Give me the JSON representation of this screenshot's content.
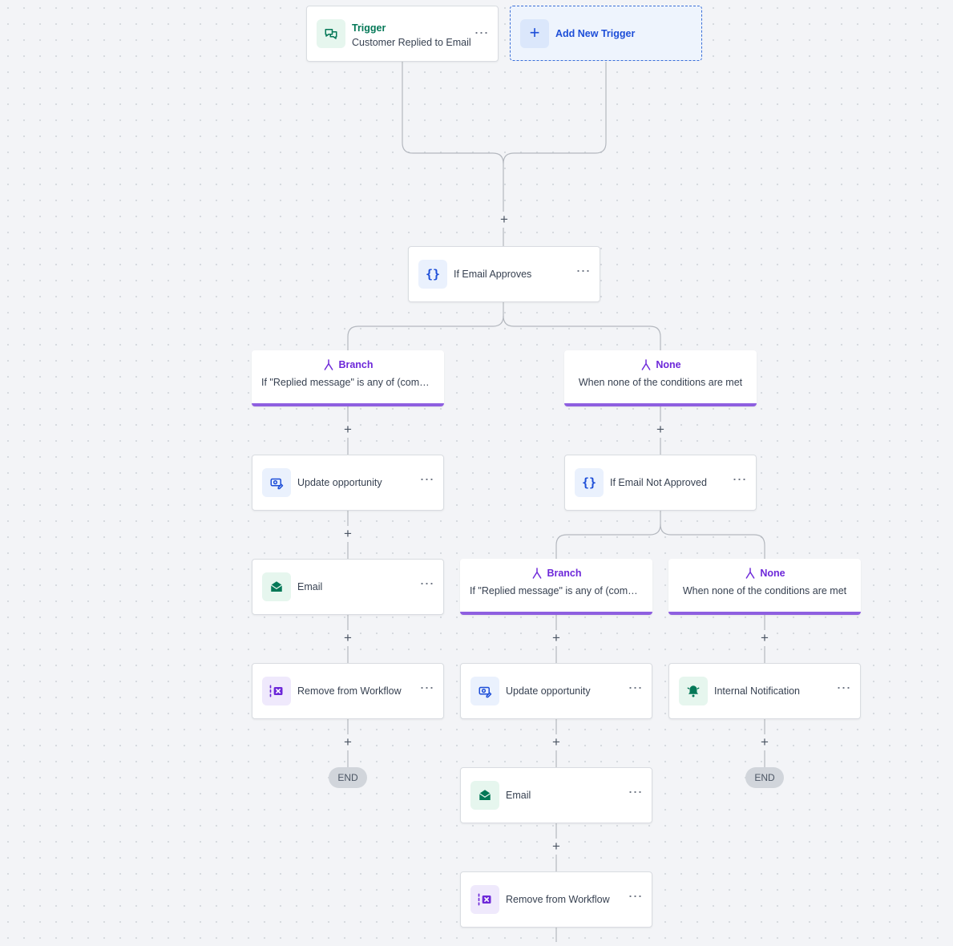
{
  "trigger": {
    "title": "Trigger",
    "subtitle": "Customer Replied to Email",
    "menu": "⋯"
  },
  "add_trigger": {
    "icon": "+",
    "label": "Add New Trigger"
  },
  "plus": "+",
  "nodes": {
    "if_email_approves": "If Email Approves",
    "update_opportunity": "Update opportunity",
    "email": "Email",
    "remove_from_workflow": "Remove from Workflow",
    "if_email_not_approved": "If Email Not Approved",
    "internal_notification": "Internal Notification",
    "menu": "⋯"
  },
  "branches": {
    "branch_title": "Branch",
    "branch_condition": "If \"Replied message\" is any of (comma...",
    "none_title": "None",
    "none_condition": "When none of the conditions are met"
  },
  "end_label": "END",
  "colors": {
    "accent_blue": "#1d4ed8",
    "trigger_green": "#047857",
    "branch_purple": "#8e5fe0",
    "connector": "#b4b8bf"
  },
  "icons": {
    "trigger": "chat-bubbles-icon",
    "condition": "braces-icon",
    "update": "opportunity-edit-icon",
    "email": "envelope-icon",
    "remove": "remove-workflow-icon",
    "notification": "bell-icon",
    "branch": "branch-fork-icon"
  }
}
